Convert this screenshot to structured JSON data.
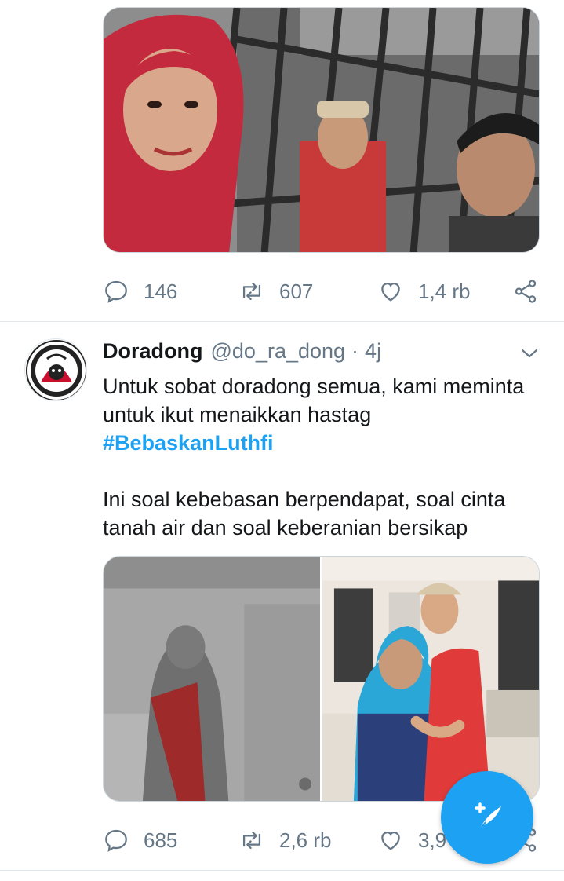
{
  "tweet_prev": {
    "media_description": "selfie-behind-bars",
    "actions": {
      "reply_count": "146",
      "retweet_count": "607",
      "like_count": "1,4 rb"
    }
  },
  "tweet": {
    "display_name": "Doradong",
    "handle": "@do_ra_dong",
    "separator": "·",
    "time": "4j",
    "avatar_text": "ULTRAS GARUDA",
    "text_line1": "Untuk sobat doradong semua, kami meminta",
    "text_line2": "untuk ikut menaikkan hastag",
    "hashtag": "#BebaskanLuthfi",
    "text_line3": "Ini soal kebebasan berpendapat, soal cinta",
    "text_line4": "tanah air dan soal keberanian bersikap",
    "actions": {
      "reply_count": "685",
      "retweet_count": "2,6 rb",
      "like_count": "3,9"
    }
  },
  "colors": {
    "accent": "#1da1f2",
    "muted": "#657786",
    "text": "#14171a",
    "border": "#e1e8ed"
  },
  "icons": [
    "reply-icon",
    "retweet-icon",
    "like-icon",
    "share-icon",
    "chevron-down-icon",
    "compose-tweet-icon"
  ]
}
